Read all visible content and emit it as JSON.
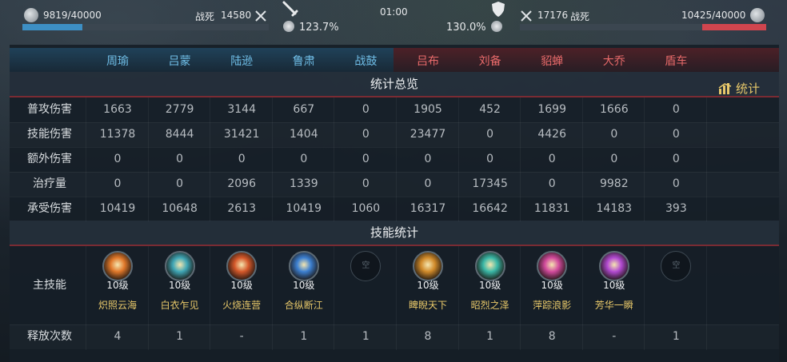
{
  "top": {
    "left": {
      "name": "",
      "hp_text": "9819/40000",
      "hp_fraction": 0.245,
      "kills_label": "战死",
      "kills_value": "14580",
      "pct": "123.7%"
    },
    "center": {
      "timer": "01:00"
    },
    "right": {
      "name": "",
      "hp_text": "10425/40000",
      "hp_fraction": 0.26,
      "kills_label": "战死",
      "kills_value": "17176",
      "pct": "130.0%"
    },
    "colors": {
      "blue": "#3d8fc4",
      "red": "#d0454e"
    }
  },
  "heroes": [
    {
      "name": "周瑜",
      "side": "blue"
    },
    {
      "name": "吕蒙",
      "side": "blue"
    },
    {
      "name": "陆逊",
      "side": "blue"
    },
    {
      "name": "鲁肃",
      "side": "blue"
    },
    {
      "name": "战鼓",
      "side": "blue"
    },
    {
      "name": "吕布",
      "side": "red"
    },
    {
      "name": "刘备",
      "side": "red"
    },
    {
      "name": "貂蝉",
      "side": "red"
    },
    {
      "name": "大乔",
      "side": "red"
    },
    {
      "name": "盾车",
      "side": "red"
    }
  ],
  "overview": {
    "title": "统计总览",
    "stats_button": "统计",
    "rows": [
      {
        "label": "普攻伤害",
        "values": [
          "1663",
          "2779",
          "3144",
          "667",
          "0",
          "1905",
          "452",
          "1699",
          "1666",
          "0"
        ]
      },
      {
        "label": "技能伤害",
        "values": [
          "11378",
          "8444",
          "31421",
          "1404",
          "0",
          "23477",
          "0",
          "4426",
          "0",
          "0"
        ]
      },
      {
        "label": "额外伤害",
        "values": [
          "0",
          "0",
          "0",
          "0",
          "0",
          "0",
          "0",
          "0",
          "0",
          "0"
        ]
      },
      {
        "label": "治疗量",
        "values": [
          "0",
          "0",
          "2096",
          "1339",
          "0",
          "0",
          "17345",
          "0",
          "9982",
          "0"
        ]
      },
      {
        "label": "承受伤害",
        "values": [
          "10419",
          "10648",
          "2613",
          "10419",
          "1060",
          "16317",
          "16642",
          "11831",
          "14183",
          "393"
        ]
      }
    ]
  },
  "skills": {
    "title": "技能统计",
    "main_label": "主技能",
    "empty_text": "空",
    "items": [
      {
        "icon": "fire-burst-icon",
        "level": "10级",
        "name": "炽照云海",
        "color": "#e0782a"
      },
      {
        "icon": "water-swirl-icon",
        "level": "10级",
        "name": "白衣乍见",
        "color": "#3fa6b5"
      },
      {
        "icon": "burning-camp-icon",
        "level": "10级",
        "name": "火烧连营",
        "color": "#d4582a"
      },
      {
        "icon": "diamond-shield-icon",
        "level": "10级",
        "name": "合纵断江",
        "color": "#3c7fd0"
      },
      {
        "icon": "empty-slot-icon",
        "level": "",
        "name": "",
        "color": ""
      },
      {
        "icon": "golden-warrior-icon",
        "level": "10级",
        "name": "睥睨天下",
        "color": "#d08a2a"
      },
      {
        "icon": "jade-blade-icon",
        "level": "10级",
        "name": "昭烈之泽",
        "color": "#3ab7a6"
      },
      {
        "icon": "pink-orb-icon",
        "level": "10级",
        "name": "萍踪浪影",
        "color": "#d14a9c"
      },
      {
        "icon": "violet-star-icon",
        "level": "10级",
        "name": "芳华一瞬",
        "color": "#b24ad1"
      },
      {
        "icon": "empty-slot-icon",
        "level": "",
        "name": "",
        "color": ""
      }
    ],
    "casts_label": "释放次数",
    "casts": [
      "4",
      "1",
      "-",
      "1",
      "1",
      "8",
      "1",
      "8",
      "-",
      "1"
    ]
  }
}
